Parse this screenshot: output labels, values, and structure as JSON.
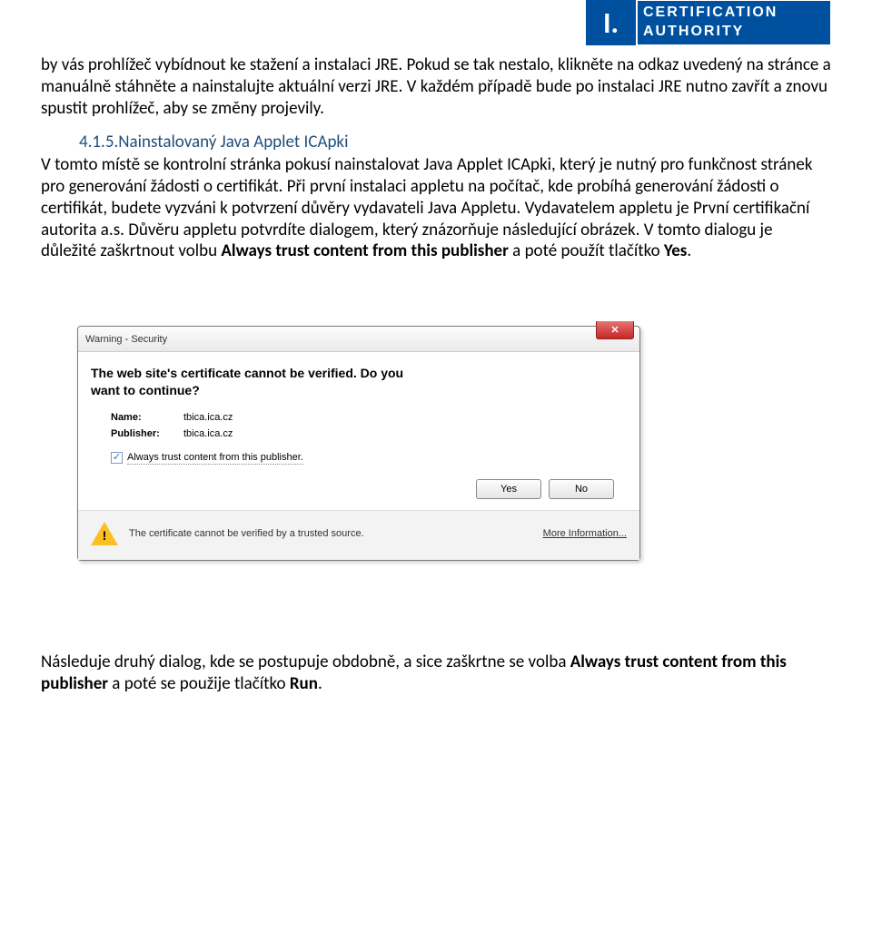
{
  "logo": {
    "mark": "I.",
    "line1": "CERTIFICATION",
    "line2": "AUTHORITY"
  },
  "paragraph1": "by vás prohlížeč vybídnout ke stažení a instalaci JRE. Pokud se tak nestalo, klikněte na odkaz uvedený na stránce a manuálně stáhněte a nainstalujte aktuální verzi JRE. V každém případě bude po instalaci JRE nutno zavřít a znovu spustit prohlížeč, aby se změny projevily.",
  "section": {
    "num": "4.1.5.",
    "title": "Nainstalovaný Java Applet  ICApki"
  },
  "paragraph2_a": "V tomto místě se kontrolní stránka pokusí nainstalovat Java Applet  ICApki, který je nutný pro funkčnost stránek pro generování žádosti o certifikát. Při první instalaci appletu na počítač, kde probíhá generování žádosti o certifikát, budete vyzváni k potvrzení důvěry vydavateli Java Appletu. Vydavatelem appletu je První certifikační autorita a.s. Důvěru appletu potvrdíte dialogem, který znázorňuje následující obrázek. V tomto dialogu je důležité zaškrtnout volbu ",
  "paragraph2_b_bold": "Always trust content from this publisher",
  "paragraph2_c": " a poté použít tlačítko ",
  "paragraph2_d_bold": "Yes",
  "paragraph2_e": ".",
  "dialog": {
    "title": "Warning - Security",
    "heading1": "The web site's certificate cannot be verified.  Do you",
    "heading2": "want to continue?",
    "name_label": "Name:",
    "name_value": "tbica.ica.cz",
    "publisher_label": "Publisher:",
    "publisher_value": "tbica.ica.cz",
    "checkbox_label": "Always trust content from this publisher.",
    "yes": "Yes",
    "no": "No",
    "footer": "The certificate cannot be verified by a trusted source.",
    "more": "More Information..."
  },
  "bottom_a": "Následuje druhý dialog, kde se postupuje obdobně, a sice zaškrtne se volba ",
  "bottom_b_bold": "Always trust content from this publisher",
  "bottom_c": " a poté se použije tlačítko ",
  "bottom_d_bold": "Run",
  "bottom_e": "."
}
